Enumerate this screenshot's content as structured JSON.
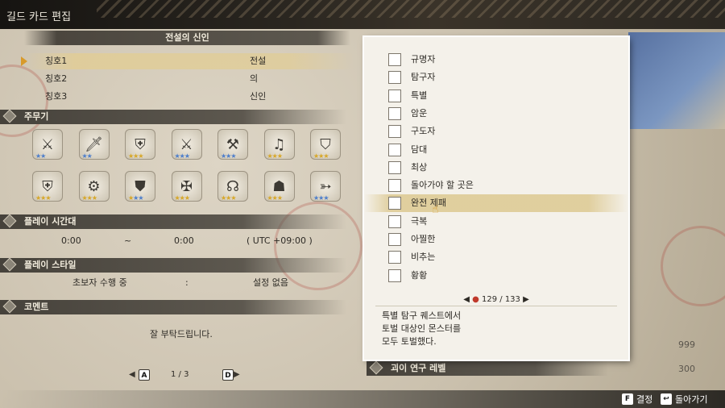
{
  "header": {
    "title": "길드 카드 편집"
  },
  "titles_section": {
    "heading": "전설의 신인",
    "rows": [
      {
        "label": "칭호1",
        "value": "전설",
        "selected": true
      },
      {
        "label": "칭호2",
        "value": "의",
        "selected": false
      },
      {
        "label": "칭호3",
        "value": "신인",
        "selected": false
      }
    ]
  },
  "weapons_section": {
    "heading": "주무기",
    "icons": [
      {
        "name": "great-sword-icon",
        "glyph": "⚔",
        "stars": [
          "b",
          "b"
        ]
      },
      {
        "name": "long-sword-icon",
        "glyph": "🗡",
        "stars": [
          "b",
          "b"
        ]
      },
      {
        "name": "sword-shield-icon",
        "glyph": "⛨",
        "stars": [
          "g",
          "g",
          "g"
        ]
      },
      {
        "name": "dual-blades-icon",
        "glyph": "⚔",
        "stars": [
          "b",
          "b",
          "b"
        ]
      },
      {
        "name": "hammer-icon",
        "glyph": "⚒",
        "stars": [
          "b",
          "b",
          "b"
        ]
      },
      {
        "name": "hunting-horn-icon",
        "glyph": "♫",
        "stars": [
          "g",
          "g",
          "g"
        ]
      },
      {
        "name": "lance-icon",
        "glyph": "⛉",
        "stars": [
          "g",
          "g",
          "g"
        ]
      },
      {
        "name": "gunlance-icon",
        "glyph": "⛨",
        "stars": [
          "g",
          "g",
          "g"
        ]
      },
      {
        "name": "switch-axe-icon",
        "glyph": "⚙",
        "stars": [
          "g",
          "g",
          "g"
        ]
      },
      {
        "name": "charge-blade-icon",
        "glyph": "⛊",
        "stars": [
          "g",
          "b",
          "b"
        ]
      },
      {
        "name": "insect-glaive-icon",
        "glyph": "✠",
        "stars": [
          "g",
          "g",
          "g"
        ]
      },
      {
        "name": "light-bowgun-icon",
        "glyph": "☊",
        "stars": [
          "g",
          "g",
          "g"
        ]
      },
      {
        "name": "heavy-bowgun-icon",
        "glyph": "☗",
        "stars": [
          "g",
          "g",
          "g"
        ]
      },
      {
        "name": "bow-icon",
        "glyph": "➳",
        "stars": [
          "b",
          "b",
          "b"
        ]
      }
    ]
  },
  "playtime_section": {
    "heading": "플레이 시간대",
    "from": "0:00",
    "sep": "~",
    "to": "0:00",
    "tz": "( UTC +09:00 )"
  },
  "playstyle_section": {
    "heading": "플레이 스타일",
    "label": "초보자 수행 중",
    "sep": ":",
    "value": "설정 없음"
  },
  "comment_section": {
    "heading": "코멘트",
    "text": "잘 부탁드립니다."
  },
  "page_nav": {
    "prev_key": "A",
    "page": "1 / 3",
    "next_key": "D"
  },
  "dropdown": {
    "items": [
      "규명자",
      "탐구자",
      "특별",
      "암운",
      "구도자",
      "담대",
      "최상",
      "돌아가야 할 곳은",
      "완전 제패",
      "극복",
      "아찔한",
      "비추는",
      "황황"
    ],
    "selected_index": 8,
    "counter": "129 / 133",
    "description": "특별 탐구 퀘스트에서\n토벌 대상인 몬스터를\n모두 토벌했다."
  },
  "right_section": {
    "heading": "괴이 연구 레벨",
    "value1": "999",
    "value2": "300"
  },
  "footer": {
    "confirm_key": "F",
    "confirm_label": "결정",
    "back_label": "돌아가기"
  }
}
